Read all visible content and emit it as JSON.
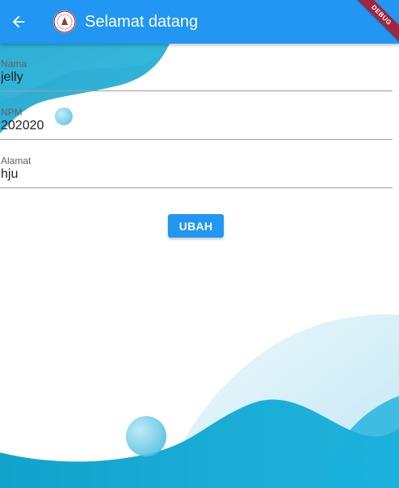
{
  "appbar": {
    "title": "Selamat datang",
    "debug_label": "DEBUG",
    "color": "#2196f3"
  },
  "form": {
    "fields": [
      {
        "label": "Nama",
        "value": "jelly"
      },
      {
        "label": "NPM",
        "value": "202020"
      },
      {
        "label": "Alamat",
        "value": "hju"
      }
    ]
  },
  "actions": {
    "submit_label": "UBAH"
  },
  "icons": {
    "back": "arrow-left-icon",
    "logo": "university-logo-icon"
  }
}
